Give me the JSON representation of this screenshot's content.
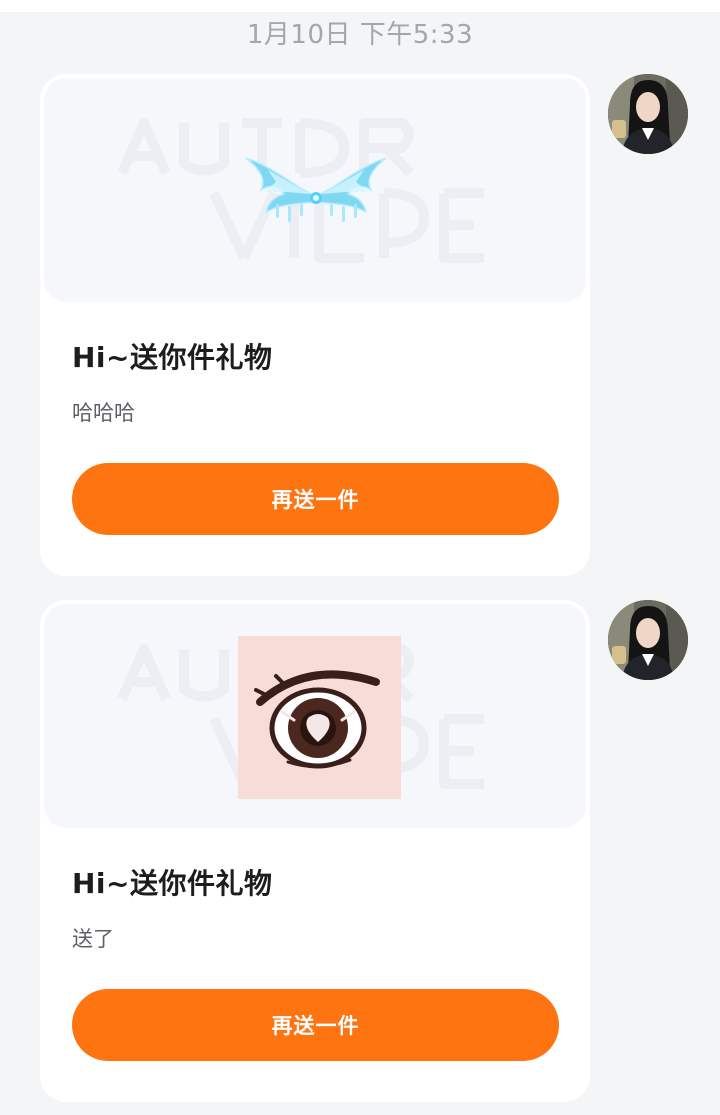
{
  "timestamp": "1月10日 下午5:33",
  "messages": [
    {
      "gift_icon": "wings-icon",
      "title": "Hi~送你件礼物",
      "message": "哈哈哈",
      "button_label": "再送一件"
    },
    {
      "gift_icon": "eye-icon",
      "title": "Hi~送你件礼物",
      "message": "送了",
      "button_label": "再送一件"
    }
  ],
  "colors": {
    "button": "#fd7411",
    "background": "#f4f5f7",
    "card": "#ffffff",
    "timestamp": "#a3a6ab"
  }
}
